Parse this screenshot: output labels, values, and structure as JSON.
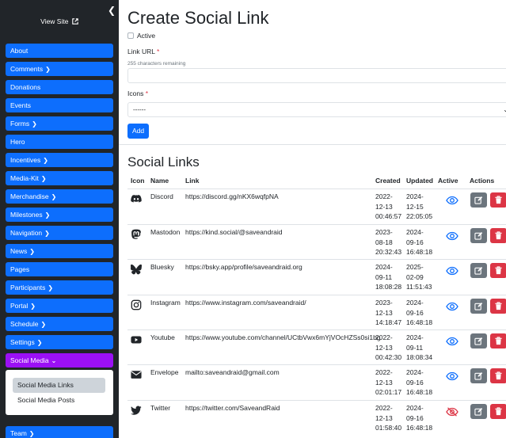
{
  "sidebar": {
    "view_site": "View Site",
    "nav": [
      {
        "label": "About",
        "chevron": false
      },
      {
        "label": "Comments",
        "chevron": true
      },
      {
        "label": "Donations",
        "chevron": false
      },
      {
        "label": "Events",
        "chevron": false
      },
      {
        "label": "Forms",
        "chevron": true
      },
      {
        "label": "Hero",
        "chevron": false
      },
      {
        "label": "Incentives",
        "chevron": true
      },
      {
        "label": "Media-Kit",
        "chevron": true
      },
      {
        "label": "Merchandise",
        "chevron": true
      },
      {
        "label": "Milestones",
        "chevron": true
      },
      {
        "label": "Navigation",
        "chevron": true
      },
      {
        "label": "News",
        "chevron": true
      },
      {
        "label": "Pages",
        "chevron": false
      },
      {
        "label": "Participants",
        "chevron": true
      },
      {
        "label": "Portal",
        "chevron": true
      },
      {
        "label": "Schedule",
        "chevron": true
      },
      {
        "label": "Settings",
        "chevron": true
      },
      {
        "label": "Social Media",
        "chevron": true,
        "active": true
      }
    ],
    "submenu": [
      "Social Media Links",
      "Social Media Posts"
    ],
    "team": {
      "label": "Team",
      "chevron": true
    }
  },
  "form": {
    "title": "Create Social Link",
    "active_label": "Active",
    "link_url_label": "Link URL",
    "chars_remaining": "255 characters remaining",
    "icons_label": "Icons",
    "icons_selected": "------",
    "add_button": "Add"
  },
  "table": {
    "title": "Social Links",
    "headers": {
      "icon": "Icon",
      "name": "Name",
      "link": "Link",
      "created": "Created",
      "updated": "Updated",
      "active": "Active",
      "actions": "Actions"
    },
    "rows": [
      {
        "icon": "discord-icon",
        "name": "Discord",
        "link": "https://discord.gg/nKX6wqfpNA",
        "created": [
          "2022-",
          "12-13",
          "00:46:57"
        ],
        "updated": [
          "2024-",
          "12-15",
          "22:05:05"
        ],
        "active": true
      },
      {
        "icon": "mastodon-icon",
        "name": "Mastodon",
        "link": "https://kind.social/@saveandraid",
        "created": [
          "2023-",
          "08-18",
          "20:32:43"
        ],
        "updated": [
          "2024-",
          "09-16",
          "16:48:18"
        ],
        "active": true
      },
      {
        "icon": "bluesky-icon",
        "name": "Bluesky",
        "link": "https://bsky.app/profile/saveandraid.org",
        "created": [
          "2024-",
          "09-11",
          "18:08:28"
        ],
        "updated": [
          "2025-",
          "02-09",
          "11:51:43"
        ],
        "active": true
      },
      {
        "icon": "instagram-icon",
        "name": "Instagram",
        "link": "https://www.instagram.com/saveandraid/",
        "created": [
          "2023-",
          "12-13",
          "14:18:47"
        ],
        "updated": [
          "2024-",
          "09-16",
          "16:48:18"
        ],
        "active": true
      },
      {
        "icon": "youtube-icon",
        "name": "Youtube",
        "link": "https://www.youtube.com/channel/UCtbVwx6mYjVOcHZSs0si1bg",
        "created": [
          "2022-",
          "12-13",
          "00:42:30"
        ],
        "updated": [
          "2024-",
          "09-11",
          "18:08:34"
        ],
        "active": true
      },
      {
        "icon": "envelope-icon",
        "name": "Envelope",
        "link": "mailto:saveandraid@gmail.com",
        "created": [
          "2022-",
          "12-13",
          "02:01:17"
        ],
        "updated": [
          "2024-",
          "09-16",
          "16:48:18"
        ],
        "active": true
      },
      {
        "icon": "twitter-icon",
        "name": "Twitter",
        "link": "https://twitter.com/SaveandRaid",
        "created": [
          "2022-",
          "12-13",
          "01:58:40"
        ],
        "updated": [
          "2024-",
          "09-16",
          "16:48:18"
        ],
        "active": false
      }
    ]
  },
  "colors": {
    "sidebar_bg": "#212529",
    "nav_blue": "#0d6efd",
    "nav_active": "#9b10f5",
    "eye_active": "#0d6efd",
    "eye_inactive": "#dc3545",
    "edit": "#6c757d",
    "delete": "#dc3545"
  }
}
